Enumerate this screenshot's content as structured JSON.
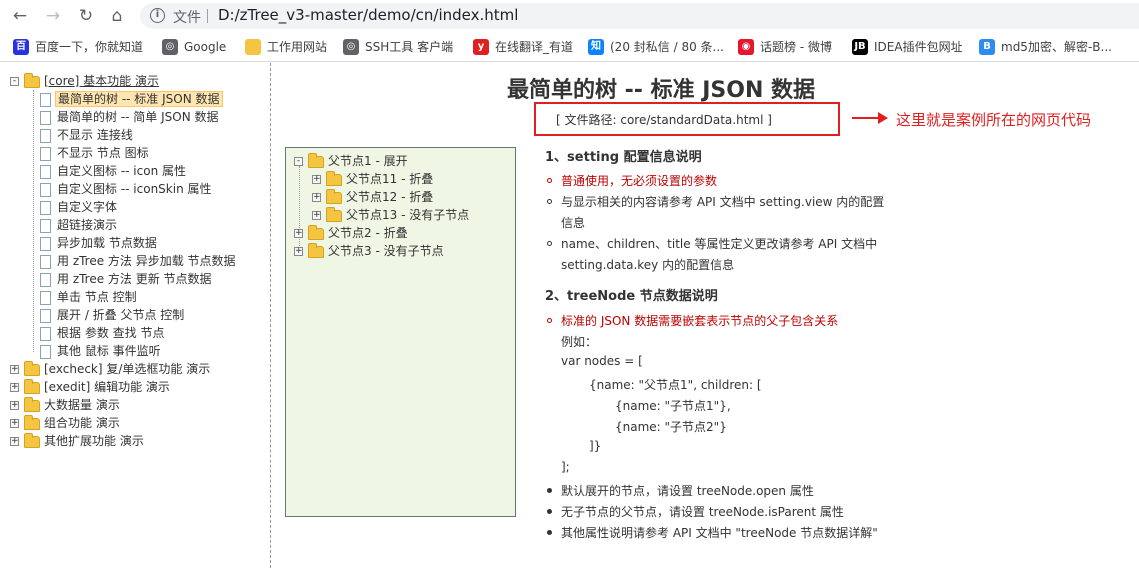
{
  "browser": {
    "url_label": "文件",
    "url": "D:/zTree_v3-master/demo/cn/index.html",
    "bookmarks": [
      {
        "label": "百度一下，你就知道",
        "icon": "baidu-icon",
        "color": "#2932e1"
      },
      {
        "label": "Google",
        "icon": "globe-icon",
        "color": "#5f6368"
      },
      {
        "label": "工作用网站",
        "icon": "folder-icon",
        "color": "#f4c542"
      },
      {
        "label": "SSH工具 客户端",
        "icon": "globe-icon",
        "color": "#5f6368"
      },
      {
        "label": "在线翻译_有道",
        "icon": "youdao-icon",
        "color": "#e02020"
      },
      {
        "label": "(20 封私信 / 80 条...",
        "icon": "zhihu-icon",
        "color": "#0a84ff"
      },
      {
        "label": "话题榜 - 微博",
        "icon": "weibo-icon",
        "color": "#e6162d"
      },
      {
        "label": "IDEA插件包网址",
        "icon": "jb-icon",
        "color": "#000000"
      },
      {
        "label": "md5加密、解密-B...",
        "icon": "b-icon",
        "color": "#2d8cf0"
      }
    ]
  },
  "left_tree": [
    {
      "label": "[core] 基本功能 演示",
      "type": "folder",
      "switch": "-",
      "level": 0,
      "link": true
    },
    {
      "label": "最简单的树 -- 标准 JSON 数据",
      "type": "doc",
      "level": 1,
      "selected": true
    },
    {
      "label": "最简单的树 -- 简单 JSON 数据",
      "type": "doc",
      "level": 1
    },
    {
      "label": "不显示 连接线",
      "type": "doc",
      "level": 1
    },
    {
      "label": "不显示 节点 图标",
      "type": "doc",
      "level": 1
    },
    {
      "label": "自定义图标 -- icon 属性",
      "type": "doc",
      "level": 1
    },
    {
      "label": "自定义图标 -- iconSkin 属性",
      "type": "doc",
      "level": 1
    },
    {
      "label": "自定义字体",
      "type": "doc",
      "level": 1
    },
    {
      "label": "超链接演示",
      "type": "doc",
      "level": 1
    },
    {
      "label": "异步加载 节点数据",
      "type": "doc",
      "level": 1
    },
    {
      "label": "用 zTree 方法 异步加载 节点数据",
      "type": "doc",
      "level": 1
    },
    {
      "label": "用 zTree 方法 更新 节点数据",
      "type": "doc",
      "level": 1
    },
    {
      "label": "单击 节点 控制",
      "type": "doc",
      "level": 1
    },
    {
      "label": "展开 / 折叠 父节点 控制",
      "type": "doc",
      "level": 1
    },
    {
      "label": "根据 参数 查找 节点",
      "type": "doc",
      "level": 1
    },
    {
      "label": "其他 鼠标 事件监听",
      "type": "doc",
      "level": 1
    },
    {
      "label": "[excheck] 复/单选框功能 演示",
      "type": "folder",
      "switch": "+",
      "level": 0
    },
    {
      "label": "[exedit] 编辑功能 演示",
      "type": "folder",
      "switch": "+",
      "level": 0
    },
    {
      "label": "大数据量 演示",
      "type": "folder",
      "switch": "+",
      "level": 0
    },
    {
      "label": "组合功能 演示",
      "type": "folder",
      "switch": "+",
      "level": 0
    },
    {
      "label": "其他扩展功能 演示",
      "type": "folder",
      "switch": "+",
      "level": 0
    }
  ],
  "page": {
    "title": "最简单的树 -- 标准 JSON 数据",
    "file_path": "[ 文件路径: core/standardData.html ]",
    "annotation": "这里就是案例所在的网页代码"
  },
  "demo_tree": [
    {
      "label": "父节点1 - 展开",
      "switch": "-",
      "level": 0
    },
    {
      "label": "父节点11 - 折叠",
      "switch": "+",
      "level": 1
    },
    {
      "label": "父节点12 - 折叠",
      "switch": "+",
      "level": 1
    },
    {
      "label": "父节点13 - 没有子节点",
      "switch": "+",
      "level": 1
    },
    {
      "label": "父节点2 - 折叠",
      "switch": "+",
      "level": 0
    },
    {
      "label": "父节点3 - 没有子节点",
      "switch": "+",
      "level": 0
    }
  ],
  "info": {
    "h1": "1、setting 配置信息说明",
    "s1_items": [
      {
        "text": "普通使用，无必须设置的参数",
        "red": true,
        "bullet": "open"
      },
      {
        "text": "与显示相关的内容请参考 API 文档中 setting.view 内的配置",
        "bullet": "open2"
      },
      {
        "text": "信息",
        "bullet": "none"
      },
      {
        "text": "name、children、title 等属性定义更改请参考 API 文档中",
        "bullet": "open2"
      },
      {
        "text": "setting.data.key 内的配置信息",
        "bullet": "none"
      }
    ],
    "h2": "2、treeNode 节点数据说明",
    "s2_items": [
      {
        "text": "标准的 JSON 数据需要嵌套表示节点的父子包含关系",
        "red": true,
        "bullet": "open",
        "indent": 0
      },
      {
        "text": "例如：",
        "bullet": "none",
        "indent": 0
      },
      {
        "text": "var nodes = [",
        "bullet": "none",
        "indent": 0
      },
      {
        "text": "{name: \"父节点1\", children: [",
        "bullet": "none",
        "indent": 1
      },
      {
        "text": "{name: \"子节点1\"},",
        "bullet": "none",
        "indent": 2
      },
      {
        "text": "{name: \"子节点2\"}",
        "bullet": "none",
        "indent": 2
      },
      {
        "text": "]}",
        "bullet": "none",
        "indent": 1
      },
      {
        "text": "];",
        "bullet": "none",
        "indent": 0
      },
      {
        "text": "默认展开的节点，请设置 treeNode.open 属性",
        "bullet": "fill",
        "indent": 0
      },
      {
        "text": "无子节点的父节点，请设置 treeNode.isParent 属性",
        "bullet": "fill",
        "indent": 0
      },
      {
        "text": "其他属性说明请参考 API 文档中 \"treeNode 节点数据详解\"",
        "bullet": "fill",
        "indent": 0
      }
    ]
  }
}
